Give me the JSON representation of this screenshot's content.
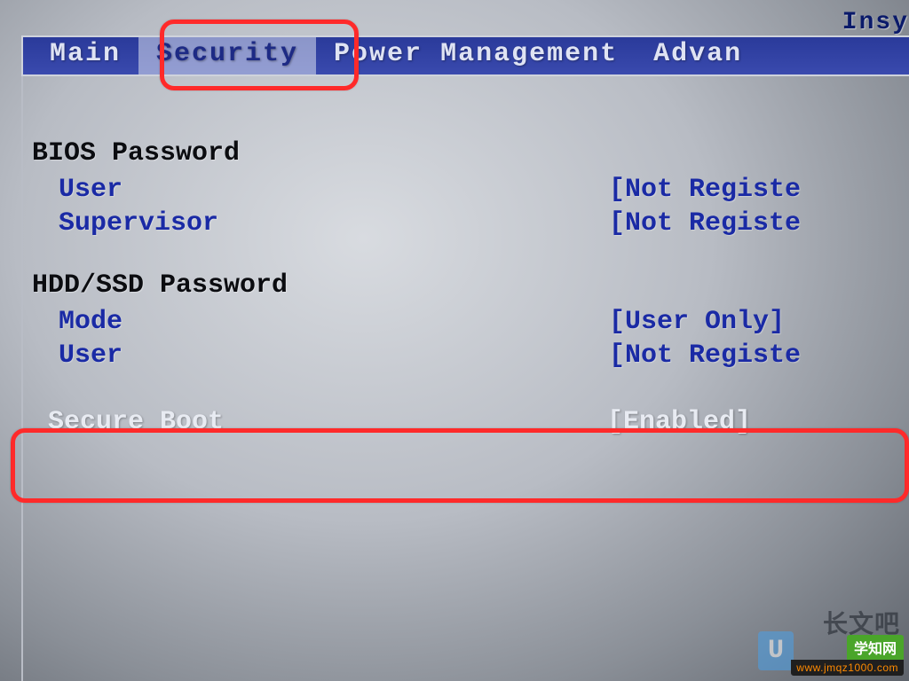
{
  "vendor": "Insy",
  "tabs": {
    "main": "Main",
    "security": "Security",
    "power": "Power Management",
    "advanced": "Advan"
  },
  "sections": {
    "bios_password": {
      "title": "BIOS Password",
      "user_label": "User",
      "user_value": "[Not Registe",
      "supervisor_label": "Supervisor",
      "supervisor_value": "[Not Registe"
    },
    "hdd_password": {
      "title": "HDD/SSD Password",
      "mode_label": "Mode",
      "mode_value": "[User Only]",
      "user_label": "User",
      "user_value": "[Not Registe"
    },
    "secure_boot": {
      "label": "Secure Boot",
      "value": "[Enabled]"
    }
  },
  "watermarks": {
    "wm1": "长文吧",
    "wm2_top": "学知网",
    "wm2_bot": "www.jmqz1000.com",
    "badge": "U"
  }
}
